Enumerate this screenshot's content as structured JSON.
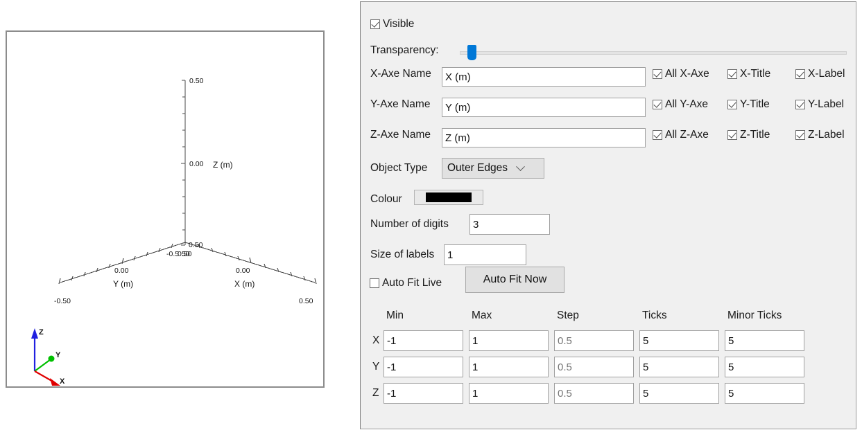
{
  "viewport": {
    "name": "3d-axes-viewport",
    "axes": {
      "z": {
        "title": "Z (m)",
        "tick_top": "0.50",
        "tick_mid": "0.00",
        "tick_bottom": "-0.50"
      },
      "x": {
        "title": "X (m)",
        "tick_mid": "0.00",
        "tick_far": "0.50",
        "tick_near": "-0.50"
      },
      "y": {
        "title": "Y (m)",
        "tick_mid": "0.00",
        "tick_far": "-0.50",
        "tick_near": "0.50"
      },
      "origin_overlap": "-0.50"
    },
    "gizmo": {
      "x_label": "X",
      "y_label": "Y",
      "z_label": "Z",
      "x_colour": "#e00000",
      "y_colour": "#00c000",
      "z_colour": "#2020e0"
    }
  },
  "panel": {
    "visible": {
      "label": "Visible",
      "checked": true
    },
    "transparency": {
      "label": "Transparency:",
      "value_pct": 2
    },
    "axes_rows": [
      {
        "name_label": "X-Axe Name",
        "name_value": "X (m)",
        "all_label": "All X-Axe",
        "all_checked": true,
        "title_label": "X-Title",
        "title_checked": true,
        "tick_label": "X-Label",
        "tick_checked": true
      },
      {
        "name_label": "Y-Axe Name",
        "name_value": "Y (m)",
        "all_label": "All Y-Axe",
        "all_checked": true,
        "title_label": "Y-Title",
        "title_checked": true,
        "tick_label": "Y-Label",
        "tick_checked": true
      },
      {
        "name_label": "Z-Axe Name",
        "name_value": "Z (m)",
        "all_label": "All Z-Axe",
        "all_checked": true,
        "title_label": "Z-Title",
        "title_checked": true,
        "tick_label": "Z-Label",
        "tick_checked": true
      }
    ],
    "object_type": {
      "label": "Object Type",
      "value": "Outer Edges"
    },
    "colour": {
      "label": "Colour",
      "value": "#000000"
    },
    "number_of_digits": {
      "label": "Number of digits",
      "value": "3"
    },
    "size_of_labels": {
      "label": "Size of labels",
      "value": "1"
    },
    "auto_fit_live": {
      "label": "Auto Fit Live",
      "checked": false
    },
    "auto_fit_now": {
      "label": "Auto Fit Now"
    },
    "grid": {
      "headers": [
        "Min",
        "Max",
        "Step",
        "Ticks",
        "Minor Ticks"
      ],
      "rows": [
        {
          "axis": "X",
          "min": "-1",
          "max": "1",
          "step": "0.5",
          "step_is_placeholder": true,
          "ticks": "5",
          "minor_ticks": "5"
        },
        {
          "axis": "Y",
          "min": "-1",
          "max": "1",
          "step": "0.5",
          "step_is_placeholder": true,
          "ticks": "5",
          "minor_ticks": "5"
        },
        {
          "axis": "Z",
          "min": "-1",
          "max": "1",
          "step": "0.5",
          "step_is_placeholder": true,
          "ticks": "5",
          "minor_ticks": "5"
        }
      ]
    }
  }
}
